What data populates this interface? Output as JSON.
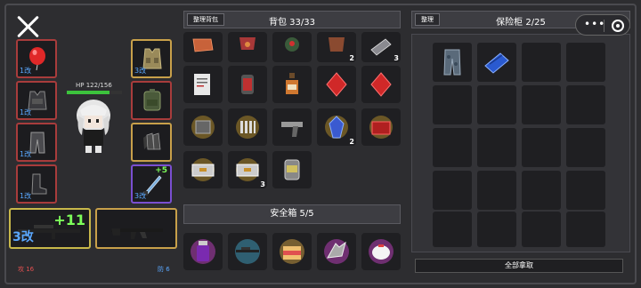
{
  "player": {
    "hp_text": "HP 122/156",
    "hp_fraction": 0.78,
    "attack_text": "攻 16",
    "defense_text": "防 6"
  },
  "equipment": {
    "left_slots": [
      {
        "name": "balloon-icon",
        "level": "1改",
        "color": "red"
      },
      {
        "name": "armor-vest-icon",
        "level": "1改",
        "color": "red"
      },
      {
        "name": "pants-icon",
        "level": "1改",
        "color": "red"
      },
      {
        "name": "boots-icon",
        "level": "1改",
        "color": "red"
      }
    ],
    "right_slots": [
      {
        "name": "tactical-vest-icon",
        "level": "3改",
        "color": "gold"
      },
      {
        "name": "backpack-icon",
        "level": "",
        "color": "red"
      },
      {
        "name": "gloves-icon",
        "level": "",
        "color": "gold"
      },
      {
        "name": "knife-icon",
        "level": "3改",
        "plus": "+5",
        "color": "purple"
      }
    ],
    "main_weapon": {
      "plus": "+11",
      "level": "3改"
    },
    "secondary_weapon": {}
  },
  "backpack": {
    "sort_label": "整理背包",
    "title": "背包 33/33",
    "items": [
      {
        "icon": "brick-icon",
        "count": ""
      },
      {
        "icon": "pouch-icon",
        "count": ""
      },
      {
        "icon": "grenade-icon",
        "count": ""
      },
      {
        "icon": "cloth-icon",
        "count": "2"
      },
      {
        "icon": "flashlight-icon",
        "count": "3"
      },
      {
        "icon": "document-icon",
        "count": ""
      },
      {
        "icon": "battery-icon",
        "count": ""
      },
      {
        "icon": "bottle-icon",
        "count": ""
      },
      {
        "icon": "red-gem-icon",
        "count": ""
      },
      {
        "icon": "red-gem-icon",
        "count": ""
      },
      {
        "icon": "machine-part-icon",
        "count": ""
      },
      {
        "icon": "bullets-icon",
        "count": ""
      },
      {
        "icon": "pistol-icon",
        "count": ""
      },
      {
        "icon": "blue-crystal-icon",
        "count": "2"
      },
      {
        "icon": "red-box-icon",
        "count": ""
      },
      {
        "icon": "ammo-case-icon",
        "count": ""
      },
      {
        "icon": "ammo-case-icon",
        "count": "3"
      },
      {
        "icon": "canister-icon",
        "count": ""
      }
    ]
  },
  "safe_box": {
    "title": "安全箱 5/5",
    "items": [
      {
        "icon": "potion-jar-icon"
      },
      {
        "icon": "rifle-icon"
      },
      {
        "icon": "cake-icon"
      },
      {
        "icon": "scrap-metal-icon"
      },
      {
        "icon": "white-orb-icon"
      }
    ]
  },
  "vault": {
    "sort_label": "整理",
    "title": "保险柜 2/25",
    "items": [
      {
        "icon": "camo-pants-icon"
      },
      {
        "icon": "blue-tarp-icon"
      }
    ],
    "take_all_label": "全部拿取"
  },
  "capsule": {
    "more": "•••"
  }
}
